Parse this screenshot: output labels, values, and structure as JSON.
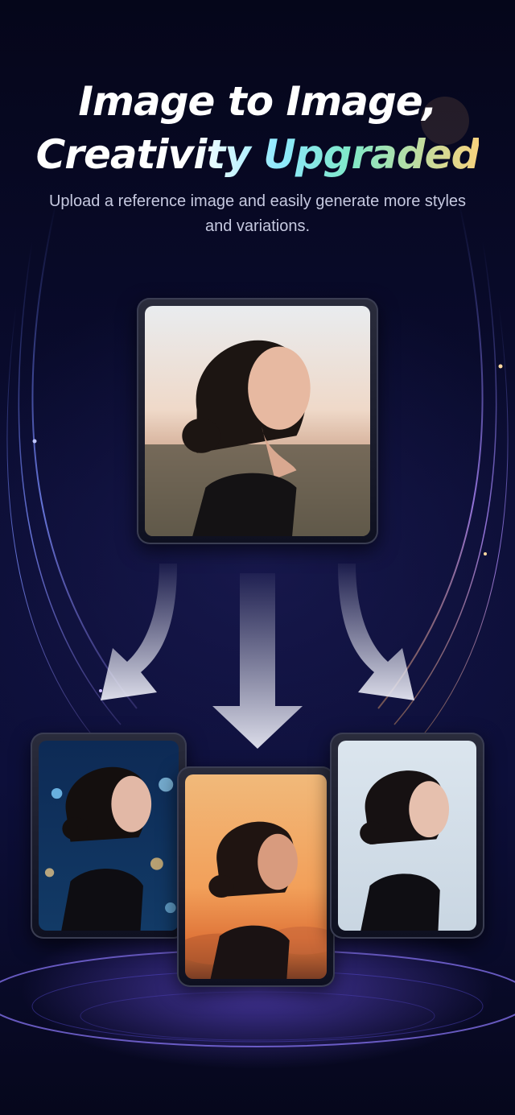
{
  "headline": {
    "line1": "Image to Image,",
    "line2_part1": "Creativ",
    "line2_part2": "ity Upgraded"
  },
  "subtitle": "Upload a reference image and easily generate more styles and variations.",
  "images": {
    "reference": "reference-portrait-sunset-hill",
    "variations": [
      "night-city-bokeh-variation",
      "golden-sunset-variation",
      "bright-sky-variation"
    ]
  },
  "colors": {
    "background": "#080a26",
    "accent_cyan": "#8fe9ff",
    "accent_gold": "#f7d27e",
    "glow_purple": "#7c5cff"
  }
}
